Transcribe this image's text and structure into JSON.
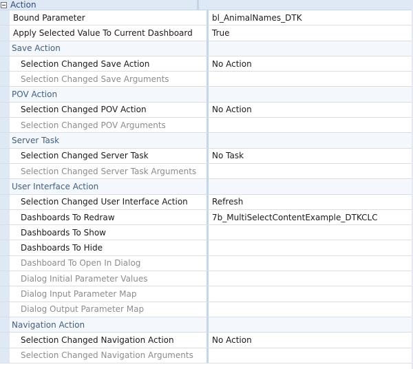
{
  "section": {
    "title": "Action",
    "collapse_icon": "minus-box-icon"
  },
  "rows": [
    {
      "name": "Bound Parameter",
      "value": "bl_AnimalNames_DTK",
      "kind": "prop",
      "level": 1
    },
    {
      "name": "Apply Selected Value To Current Dashboard",
      "value": "True",
      "kind": "prop",
      "level": 1
    },
    {
      "name": "Save Action",
      "value": "",
      "kind": "cat"
    },
    {
      "name": "Selection Changed Save Action",
      "value": "No Action",
      "kind": "prop",
      "level": 2
    },
    {
      "name": "Selection Changed Save Arguments",
      "value": "",
      "kind": "dim",
      "level": 2
    },
    {
      "name": "POV Action",
      "value": "",
      "kind": "cat"
    },
    {
      "name": "Selection Changed POV Action",
      "value": "No Action",
      "kind": "prop",
      "level": 2
    },
    {
      "name": "Selection Changed POV Arguments",
      "value": "",
      "kind": "dim",
      "level": 2
    },
    {
      "name": "Server Task",
      "value": "",
      "kind": "cat"
    },
    {
      "name": "Selection Changed Server Task",
      "value": "No Task",
      "kind": "prop",
      "level": 2
    },
    {
      "name": "Selection Changed Server Task Arguments",
      "value": "",
      "kind": "dim",
      "level": 2
    },
    {
      "name": "User Interface Action",
      "value": "",
      "kind": "cat"
    },
    {
      "name": "Selection Changed User Interface Action",
      "value": "Refresh",
      "kind": "prop",
      "level": 2
    },
    {
      "name": "Dashboards To Redraw",
      "value": "7b_MultiSelectContentExample_DTKCLC",
      "kind": "prop",
      "level": 2
    },
    {
      "name": "Dashboards To Show",
      "value": "",
      "kind": "prop",
      "level": 2
    },
    {
      "name": "Dashboards To Hide",
      "value": "",
      "kind": "prop",
      "level": 2
    },
    {
      "name": "Dashboard To Open In Dialog",
      "value": "",
      "kind": "dim",
      "level": 2
    },
    {
      "name": "Dialog Initial Parameter Values",
      "value": "",
      "kind": "dim",
      "level": 2
    },
    {
      "name": "Dialog Input Parameter Map",
      "value": "",
      "kind": "dim",
      "level": 2
    },
    {
      "name": "Dialog Output Parameter Map",
      "value": "",
      "kind": "dim",
      "level": 2
    },
    {
      "name": "Navigation Action",
      "value": "",
      "kind": "cat"
    },
    {
      "name": "Selection Changed Navigation Action",
      "value": "No Action",
      "kind": "prop",
      "level": 2
    },
    {
      "name": "Selection Changed Navigation Arguments",
      "value": "",
      "kind": "dim",
      "level": 2
    }
  ]
}
